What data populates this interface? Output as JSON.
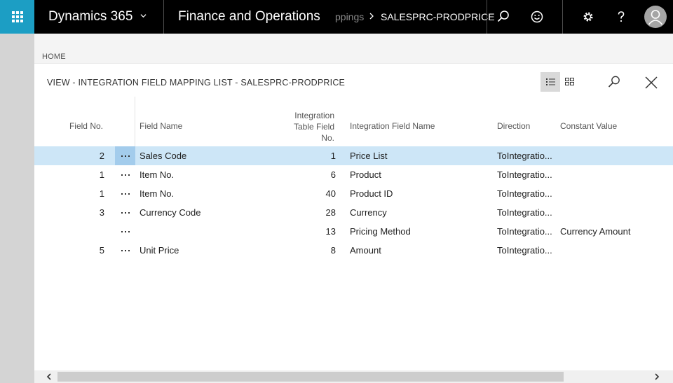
{
  "topbar": {
    "brand": "Dynamics 365",
    "app_title": "Finance and Operations",
    "breadcrumb_prev": "ppings",
    "breadcrumb_current": "SALESPRC-PRODPRICE",
    "icons": [
      "waffle-icon",
      "chevron-down-icon",
      "search-icon",
      "smiley-icon",
      "gear-icon",
      "help-icon",
      "user-avatar-icon"
    ]
  },
  "home": {
    "label": "HOME"
  },
  "view": {
    "title": "VIEW - INTEGRATION FIELD MAPPING LIST - SALESPRC-PRODPRICE",
    "toolbar_icons": [
      "list-view-icon",
      "grid-view-icon",
      "search-icon",
      "close-icon"
    ]
  },
  "table": {
    "headers": {
      "field_no": "Field No.",
      "field_name": "Field Name",
      "int_field_no_line1": "Integration",
      "int_field_no_line2": "Table Field",
      "int_field_no_line3": "No.",
      "int_field_name": "Integration Field Name",
      "direction": "Direction",
      "constant_value": "Constant Value"
    },
    "rows": [
      {
        "field_no": "2",
        "field_name": "Sales Code",
        "int_field_no": "1",
        "int_field_name": "Price List",
        "direction": "ToIntegratio...",
        "constant_value": ""
      },
      {
        "field_no": "1",
        "field_name": "Item No.",
        "int_field_no": "6",
        "int_field_name": "Product",
        "direction": "ToIntegratio...",
        "constant_value": ""
      },
      {
        "field_no": "1",
        "field_name": "Item No.",
        "int_field_no": "40",
        "int_field_name": "Product ID",
        "direction": "ToIntegratio...",
        "constant_value": ""
      },
      {
        "field_no": "3",
        "field_name": "Currency Code",
        "int_field_no": "28",
        "int_field_name": "Currency",
        "direction": "ToIntegratio...",
        "constant_value": ""
      },
      {
        "field_no": "",
        "field_name": "",
        "int_field_no": "13",
        "int_field_name": "Pricing Method",
        "direction": "ToIntegratio...",
        "constant_value": "Currency Amount"
      },
      {
        "field_no": "5",
        "field_name": "Unit Price",
        "int_field_no": "8",
        "int_field_name": "Amount",
        "direction": "ToIntegratio...",
        "constant_value": ""
      }
    ],
    "selected_row": 0
  },
  "colors": {
    "topbar_bg": "#000000",
    "waffle_bg": "#1c9ec4",
    "selected_row_bg": "#cde6f7",
    "selected_dots_bg": "#a3ccec"
  }
}
